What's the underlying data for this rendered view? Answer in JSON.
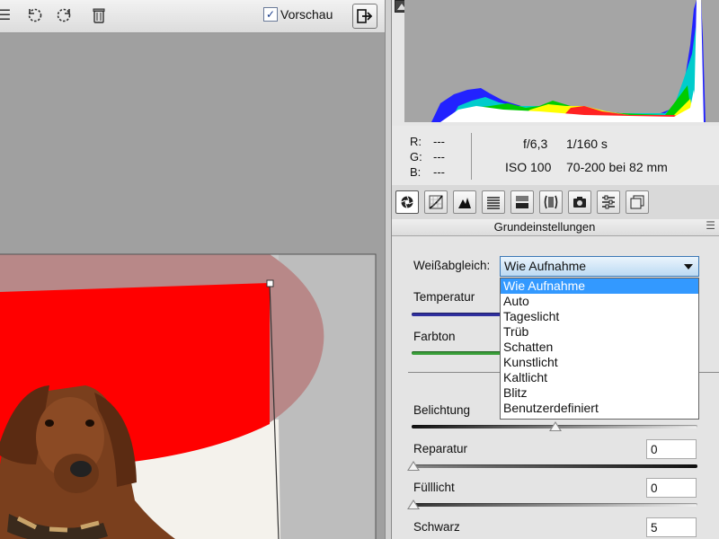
{
  "toolbar": {
    "preview_label": "Vorschau",
    "preview_checked": true,
    "icons": [
      "menu-icon",
      "rotate-left-icon",
      "rotate-right-icon",
      "trash-icon",
      "fullscreen-icon"
    ]
  },
  "info": {
    "r_label": "R:",
    "r_value": "---",
    "g_label": "G:",
    "g_value": "---",
    "b_label": "B:",
    "b_value": "---",
    "aperture": "f/6,3",
    "shutter": "1/160 s",
    "iso": "ISO 100",
    "lens": "70-200 bei 82 mm"
  },
  "tabs": [
    "basic-icon",
    "tone-curve-icon",
    "detail-icon",
    "hsl-icon",
    "split-toning-icon",
    "lens-icon",
    "camera-calibration-icon",
    "presets-icon",
    "snapshots-icon"
  ],
  "panel": {
    "title": "Grundeinstellungen",
    "wb_label": "Weißabgleich:",
    "wb_value": "Wie Aufnahme",
    "wb_options": [
      "Wie Aufnahme",
      "Auto",
      "Tageslicht",
      "Trüb",
      "Schatten",
      "Kunstlicht",
      "Kaltlicht",
      "Blitz",
      "Benutzerdefiniert"
    ],
    "temperature_label": "Temperatur",
    "tint_label": "Farbton",
    "exposure_label": "Belichtung",
    "exposure_level": 0.5,
    "recovery_label": "Reparatur",
    "recovery_value": "0",
    "fill_label": "Fülllicht",
    "fill_value": "0",
    "black_label": "Schwarz",
    "black_value": "5"
  },
  "colors": {
    "selection": "#3399ff",
    "mask_red": "#ff0000",
    "mask_pink": "#b88888",
    "temperature_track": "#3030a0",
    "tint_track": "#3aa03a"
  }
}
